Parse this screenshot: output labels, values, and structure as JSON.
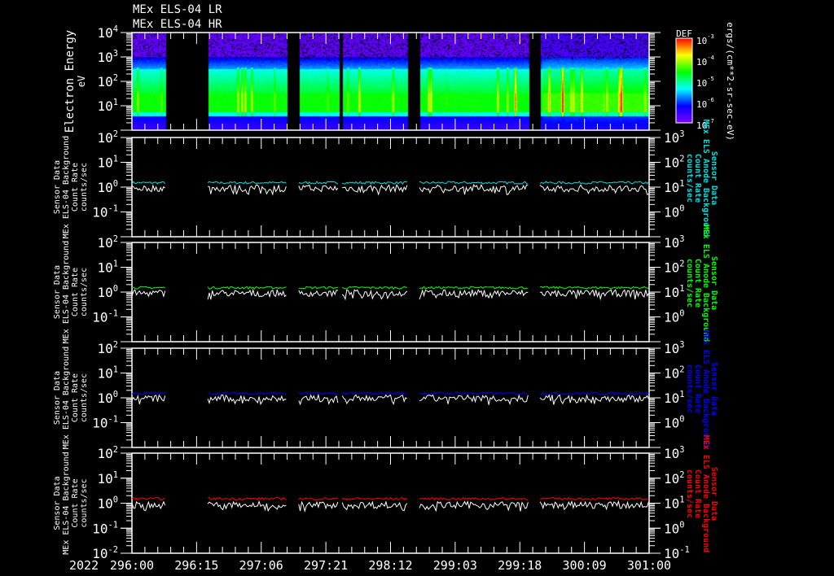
{
  "titles": [
    "MEx ELS-04 LR",
    "MEx ELS-04 HR"
  ],
  "xaxis": {
    "year": "2022",
    "labels": [
      "296:00",
      "296:15",
      "297:06",
      "297:21",
      "298:12",
      "299:03",
      "299:18",
      "300:09",
      "301:00"
    ]
  },
  "colors": {
    "background": "#000000",
    "axes": "#ffffff",
    "panel1": "#00e0e0",
    "panel2": "#00ff00",
    "panel3": "#0000ff",
    "panel4": "#ff0000",
    "reference_line": "#ffffff"
  },
  "chart_data": {
    "type": "heatmap+line",
    "x_unit": "hours since 2022 DOY 296:00",
    "xlim": [
      0,
      120
    ],
    "data_segments_hours": [
      [
        0,
        7.9
      ],
      [
        17.6,
        35.9
      ],
      [
        38.7,
        48.0
      ],
      [
        48.8,
        63.9
      ],
      [
        66.7,
        92.0
      ],
      [
        94.7,
        120
      ]
    ],
    "spectrogram": {
      "type": "heatmap",
      "ylabel": "Electron Energy",
      "yunits": "eV",
      "ylim": [
        1,
        10000
      ],
      "yscale": "log",
      "ytick_exponents": [
        "4",
        "3",
        "2",
        "1"
      ],
      "colorbar": {
        "title": "DEF",
        "units": "ergs/(cm**2-sr-sec-eV)",
        "range": [
          1e-07,
          0.001
        ],
        "tick_exponents": [
          "-3",
          "-4",
          "-5",
          "-6",
          "-7"
        ]
      },
      "peak_energy_eV": 15
    },
    "panels": [
      {
        "type": "line",
        "left_label": [
          "Sensor Data",
          "MEx ELS-04 Background",
          "Count Rate",
          "counts/sec"
        ],
        "right_label": [
          "Sensor Data",
          "MEx ELS Anode Background",
          "Count Rate",
          "counts/sec"
        ],
        "left_ylim": [
          0.01,
          100
        ],
        "right_ylim": [
          0.1,
          1000
        ],
        "left_tick_exponents": [
          "2",
          "1",
          "0",
          "-1"
        ],
        "right_tick_exponents": [
          "3",
          "2",
          "1",
          "0"
        ],
        "series": [
          {
            "name": "anode background",
            "color": "#00e0e0",
            "mean": 1.5
          },
          {
            "name": "ELS-04 background",
            "color": "#ffffff",
            "mean": 0.9
          }
        ]
      },
      {
        "type": "line",
        "left_label": [
          "Sensor Data",
          "MEx ELS-04 Background",
          "Count Rate",
          "counts/sec"
        ],
        "right_label": [
          "Sensor Data",
          "MEx ELS Anode Background",
          "Count Rate",
          "counts/sec"
        ],
        "left_ylim": [
          0.01,
          100
        ],
        "right_ylim": [
          0.1,
          1000
        ],
        "left_tick_exponents": [
          "2",
          "1",
          "0",
          "-1"
        ],
        "right_tick_exponents": [
          "3",
          "2",
          "1",
          "0"
        ],
        "series": [
          {
            "name": "anode background",
            "color": "#00ff00",
            "mean": 1.5
          },
          {
            "name": "ELS-04 background",
            "color": "#ffffff",
            "mean": 0.9
          }
        ]
      },
      {
        "type": "line",
        "left_label": [
          "Sensor Data",
          "MEx ELS-04 Background",
          "Count Rate",
          "counts/sec"
        ],
        "right_label": [
          "Sensor Data",
          "MEx ELS Anode Background",
          "Count Rate",
          "counts/sec"
        ],
        "left_ylim": [
          0.01,
          100
        ],
        "right_ylim": [
          0.1,
          1000
        ],
        "left_tick_exponents": [
          "2",
          "1",
          "0",
          "-1"
        ],
        "right_tick_exponents": [
          "3",
          "2",
          "1",
          "0"
        ],
        "series": [
          {
            "name": "anode background",
            "color": "#0000ff",
            "mean": 1.5
          },
          {
            "name": "ELS-04 background",
            "color": "#ffffff",
            "mean": 0.95
          }
        ]
      },
      {
        "type": "line",
        "left_label": [
          "Sensor Data",
          "MEx ELS-04 Background",
          "Count Rate",
          "counts/sec"
        ],
        "right_label": [
          "Sensor Data",
          "MEx ELS Anode Background",
          "Count Rate",
          "counts/sec"
        ],
        "left_ylim": [
          0.01,
          100
        ],
        "right_ylim": [
          0.1,
          1000
        ],
        "left_tick_exponents": [
          "2",
          "1",
          "0",
          "-1",
          "-2"
        ],
        "right_tick_exponents": [
          "3",
          "2",
          "1",
          "0",
          "-1"
        ],
        "series": [
          {
            "name": "anode background",
            "color": "#ff0000",
            "mean": 1.5
          },
          {
            "name": "ELS-04 background",
            "color": "#ffffff",
            "mean": 0.85
          }
        ]
      }
    ]
  }
}
